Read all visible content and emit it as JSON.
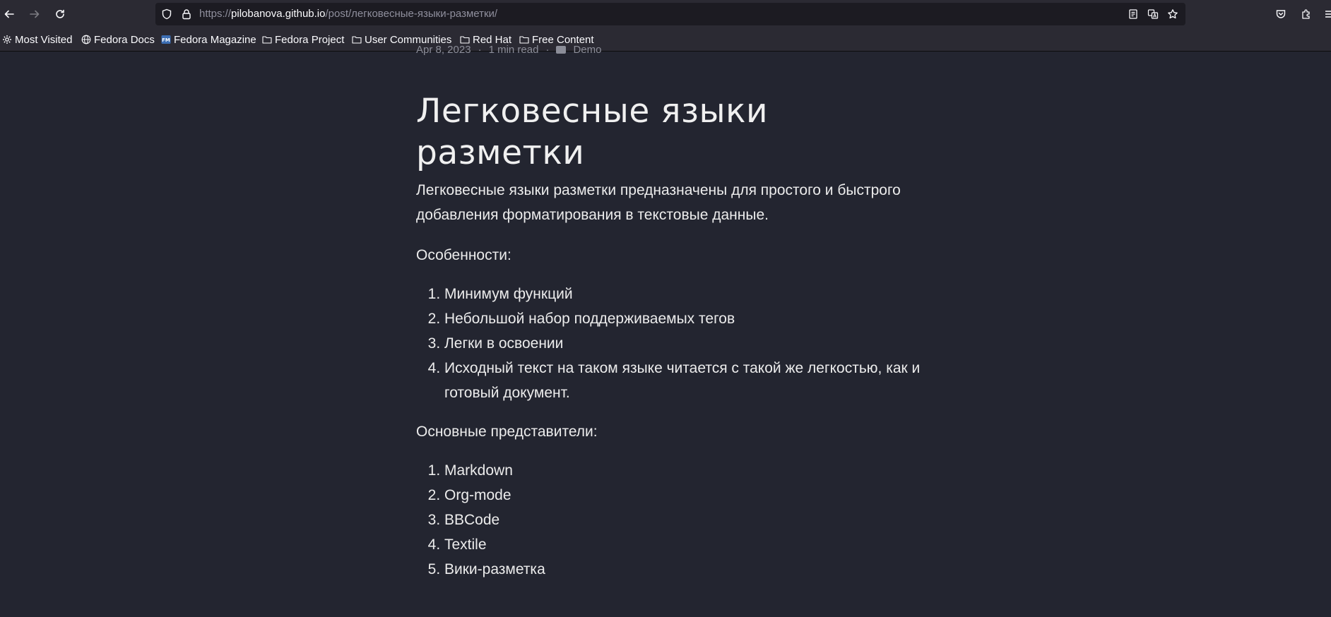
{
  "browser": {
    "url_prefix": "https://",
    "url_host": "pilobanova.github.io",
    "url_path": "/post/легковесные-языки-разметки/"
  },
  "bookmarks": [
    {
      "label": "Most Visited",
      "icon": "gear-icon"
    },
    {
      "label": "Fedora Docs",
      "icon": "globe-icon"
    },
    {
      "label": "Fedora Magazine",
      "icon": "fm-icon"
    },
    {
      "label": "Fedora Project",
      "icon": "folder-icon"
    },
    {
      "label": "User Communities",
      "icon": "folder-icon"
    },
    {
      "label": "Red Hat",
      "icon": "folder-icon"
    },
    {
      "label": "Free Content",
      "icon": "folder-icon"
    }
  ],
  "post": {
    "meta_date": "Apr 8, 2023",
    "meta_read": "1 min read",
    "meta_category": "Demo",
    "title": "Легковесные языки разметки",
    "intro": "Легковесные языки разметки предназначены для простого и быстрого добавления форматирования в текстовые данные.",
    "features_label": "Особенности:",
    "features": [
      "Минимум функций",
      "Небольшой набор поддерживаемых тегов",
      "Легки в освоении",
      "Исходный текст на таком языке читается с такой же легкостью, как и готовый документ."
    ],
    "representatives_label": "Основные представители:",
    "representatives": [
      "Markdown",
      "Org-mode",
      "BBCode",
      "Textile",
      "Вики-разметка"
    ]
  }
}
